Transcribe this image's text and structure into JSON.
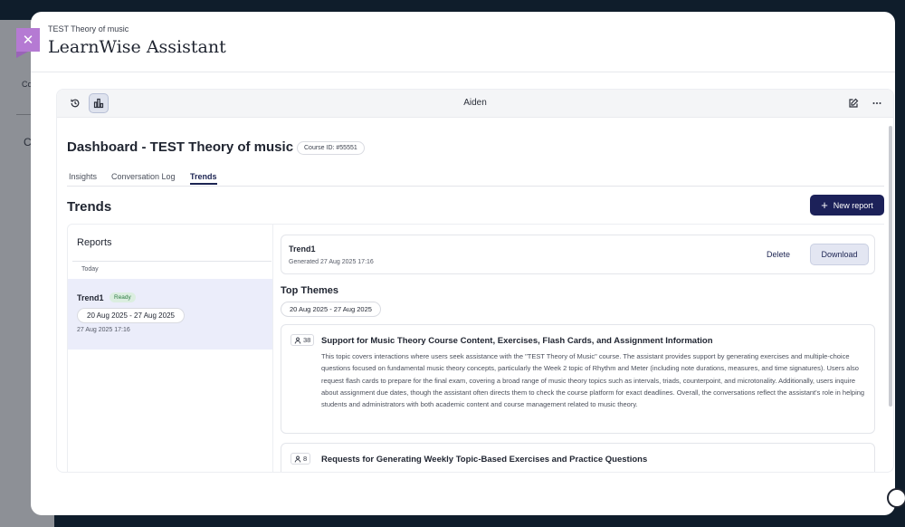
{
  "background": {
    "tab_label": "Co",
    "heading_letter": "C"
  },
  "modal": {
    "subtitle": "TEST Theory of music",
    "title": "LearnWise Assistant"
  },
  "panel": {
    "assistant_name": "Aiden"
  },
  "dashboard": {
    "title": "Dashboard - TEST Theory of music",
    "course_id": "Course ID: #55551",
    "tabs": [
      {
        "label": "Insights",
        "active": false
      },
      {
        "label": "Conversation Log",
        "active": false
      },
      {
        "label": "Trends",
        "active": true
      }
    ]
  },
  "trends": {
    "title": "Trends",
    "new_report_label": "New report",
    "reports_heading": "Reports",
    "group_label": "Today",
    "reports": [
      {
        "name": "Trend1",
        "status": "Ready",
        "range": "20 Aug 2025 - 27 Aug 2025",
        "date": "27 Aug 2025 17:16"
      }
    ]
  },
  "report_detail": {
    "name": "Trend1",
    "generated": "Generated 27 Aug 2025 17:16",
    "delete_label": "Delete",
    "download_label": "Download",
    "themes_title": "Top Themes",
    "themes_range": "20 Aug 2025 - 27 Aug 2025",
    "themes": [
      {
        "count": "38",
        "title": "Support for Music Theory Course Content, Exercises, Flash Cards, and Assignment Information",
        "description": "This topic covers interactions where users seek assistance with the \"TEST Theory of Music\" course. The assistant provides support by generating exercises and multiple-choice questions focused on fundamental music theory concepts, particularly the Week 2 topic of Rhythm and Meter (including note durations, measures, and time signatures). Users also request flash cards to prepare for the final exam, covering a broad range of music theory topics such as intervals, triads, counterpoint, and microtonality. Additionally, users inquire about assignment due dates, though the assistant often directs them to check the course platform for exact deadlines. Overall, the conversations reflect the assistant's role in helping students and administrators with both academic content and course management related to music theory."
      },
      {
        "count": "8",
        "title": "Requests for Generating Weekly Topic-Based Exercises and Practice Questions",
        "description": ""
      }
    ]
  },
  "colors": {
    "primary": "#1c2159",
    "accent_close": "#b57ad3",
    "selected_item": "#ebedfa",
    "ready": "#2f7d45"
  }
}
